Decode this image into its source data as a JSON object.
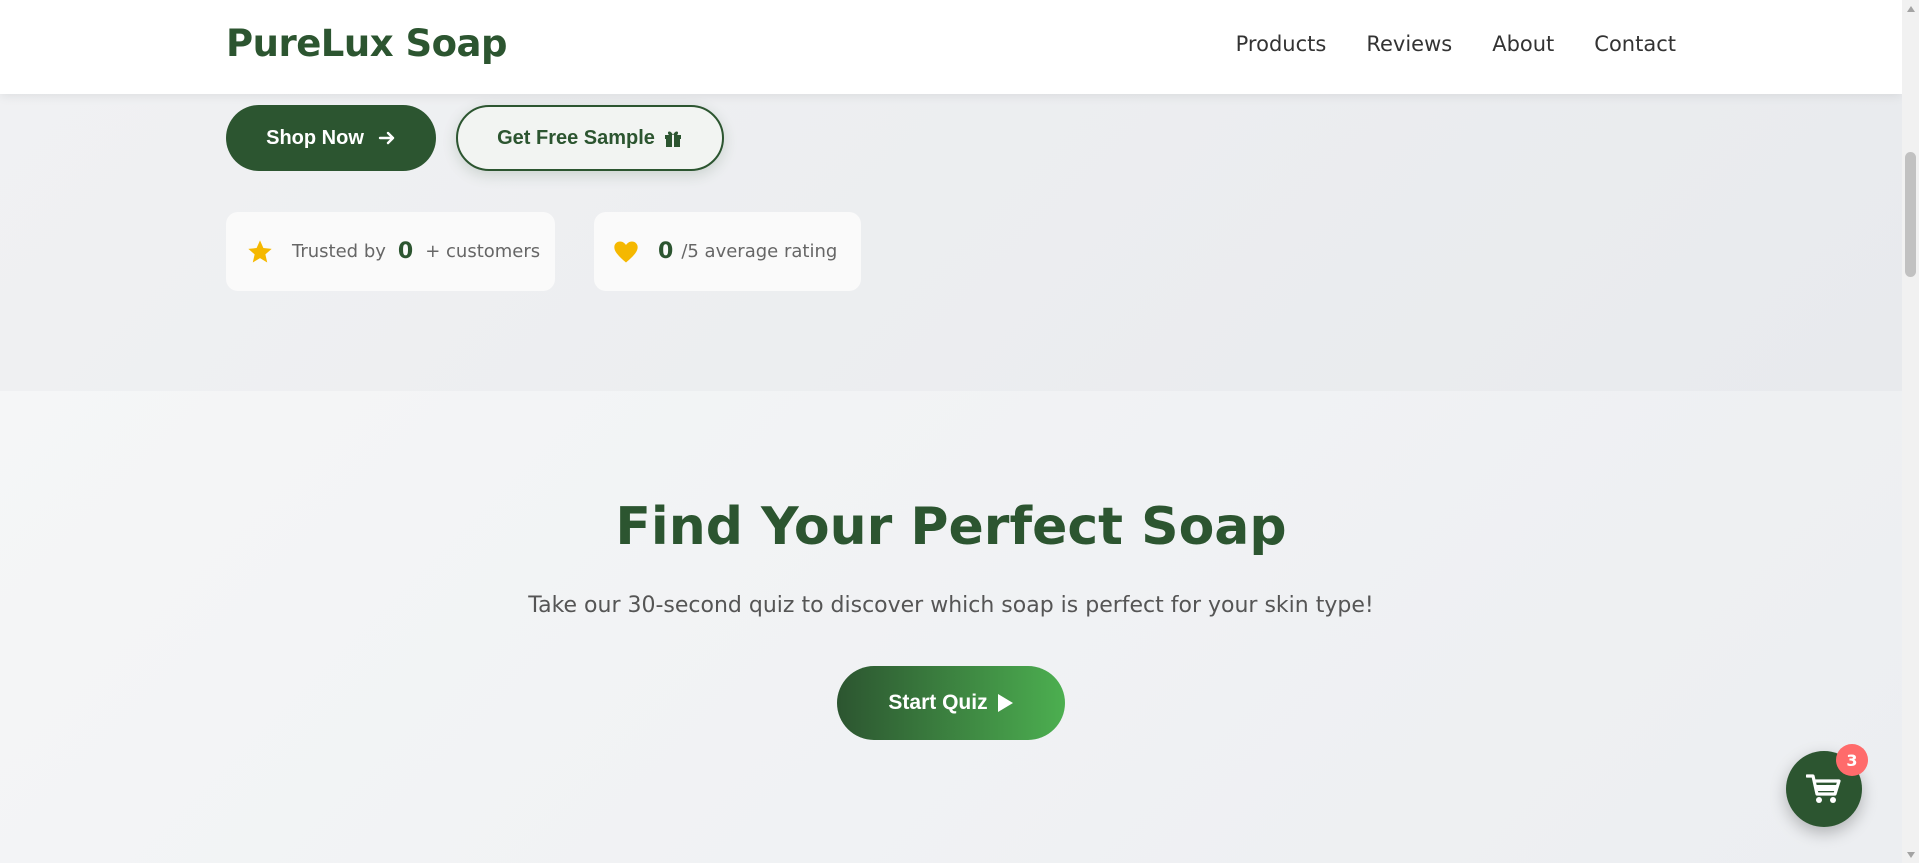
{
  "header": {
    "logo": "PureLux Soap",
    "nav": [
      "Products",
      "Reviews",
      "About",
      "Contact"
    ]
  },
  "hero": {
    "shop_label": "Shop Now",
    "sample_label": "Get Free Sample",
    "stats": {
      "customers_prefix": "Trusted by",
      "customers_value": "0",
      "customers_suffix": "+ customers",
      "rating_value": "0",
      "rating_suffix": "/5 average rating"
    }
  },
  "quiz": {
    "title": "Find Your Perfect Soap",
    "subtitle": "Take our 30-second quiz to discover which soap is perfect for your skin type!",
    "button_label": "Start Quiz"
  },
  "cart": {
    "count": "3"
  },
  "colors": {
    "brand": "#2c5530",
    "accent_gradient_end": "#4caf50",
    "star": "#f5b800",
    "badge": "#ff6b6b"
  },
  "icons": {
    "shop": "arrow-right-icon",
    "sample": "gift-icon",
    "customers": "star-icon",
    "rating": "heart-icon",
    "quiz": "play-icon",
    "cart": "cart-icon"
  }
}
